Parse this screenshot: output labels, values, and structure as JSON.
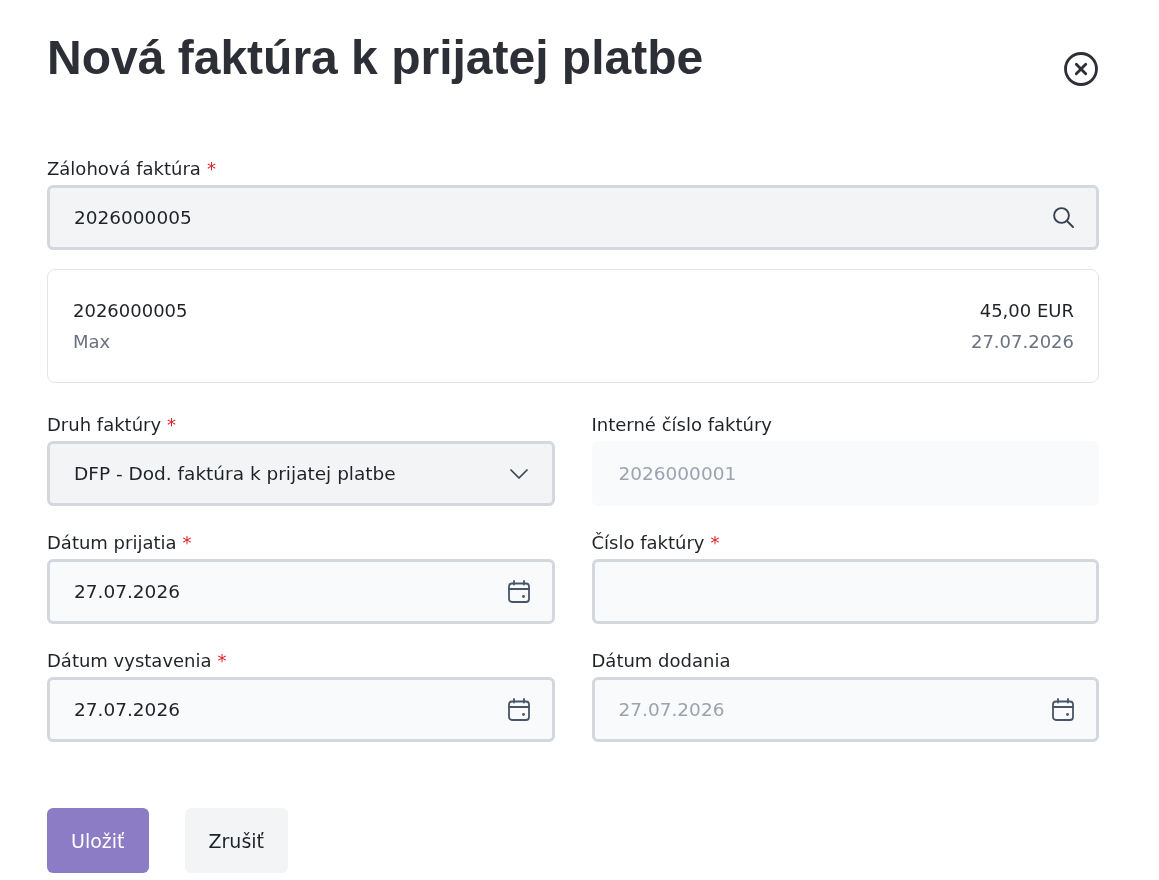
{
  "dialog": {
    "title": "Nová faktúra k prijatej platbe"
  },
  "advance_invoice": {
    "label": "Zálohová faktúra",
    "required_mark": "*",
    "value": "2026000005"
  },
  "selected_invoice": {
    "number": "2026000005",
    "amount": "45,00 EUR",
    "name": "Max",
    "date": "27.07.2026"
  },
  "fields": [
    {
      "kind": "select",
      "label": "Druh faktúry",
      "required_mark": "*",
      "value": "DFP - Dod. faktúra k prijatej platbe",
      "disabled": false
    },
    {
      "kind": "text",
      "label": "Interné číslo faktúry",
      "value": "2026000001",
      "disabled": true
    },
    {
      "kind": "date",
      "label": "Dátum prijatia",
      "required_mark": "*",
      "value": "27.07.2026",
      "disabled": false
    },
    {
      "kind": "text",
      "label": "Číslo faktúry",
      "required_mark": "*",
      "disabled": false
    },
    {
      "kind": "date",
      "label": "Dátum vystavenia",
      "required_mark": "*",
      "value": "27.07.2026",
      "disabled": false
    },
    {
      "kind": "date",
      "label": "Dátum dodania",
      "placeholder": "27.07.2026",
      "disabled": false
    }
  ],
  "buttons": [
    {
      "label": "Uložiť",
      "kind": "primary"
    },
    {
      "label": "Zrušiť",
      "kind": "secondary"
    }
  ]
}
